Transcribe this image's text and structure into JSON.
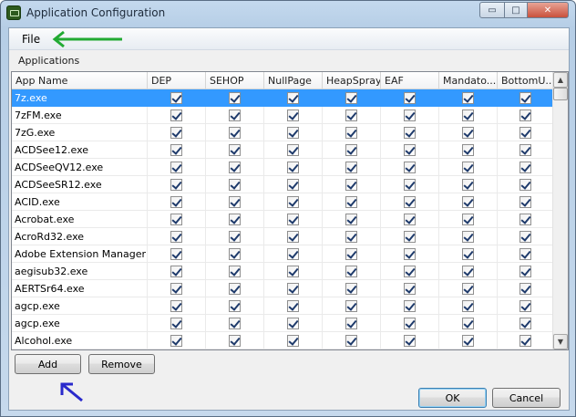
{
  "window": {
    "title": "Application Configuration"
  },
  "menu": {
    "file": "File"
  },
  "group_label": "Applications",
  "columns": [
    "App Name",
    "DEP",
    "SEHOP",
    "NullPage",
    "HeapSpray",
    "EAF",
    "Mandato...",
    "BottomU..."
  ],
  "rows": [
    {
      "name": "7z.exe",
      "selected": true
    },
    {
      "name": "7zFM.exe"
    },
    {
      "name": "7zG.exe"
    },
    {
      "name": "ACDSee12.exe"
    },
    {
      "name": "ACDSeeQV12.exe"
    },
    {
      "name": "ACDSeeSR12.exe"
    },
    {
      "name": "ACID.exe"
    },
    {
      "name": "Acrobat.exe"
    },
    {
      "name": "AcroRd32.exe"
    },
    {
      "name": "Adobe Extension Manager ..."
    },
    {
      "name": "aegisub32.exe"
    },
    {
      "name": "AERTSr64.exe"
    },
    {
      "name": "agcp.exe"
    },
    {
      "name": "agcp.exe"
    },
    {
      "name": "Alcohol.exe"
    }
  ],
  "buttons": {
    "add": "Add",
    "remove": "Remove",
    "ok": "OK",
    "cancel": "Cancel"
  },
  "colors": {
    "selection": "#3399ff",
    "annotation_green": "#22aa33",
    "annotation_blue": "#2a2acc"
  },
  "icons": {
    "scroll_up": "▲",
    "scroll_down": "▼",
    "minimize": "▭",
    "maximize": "□",
    "close": "✕"
  }
}
